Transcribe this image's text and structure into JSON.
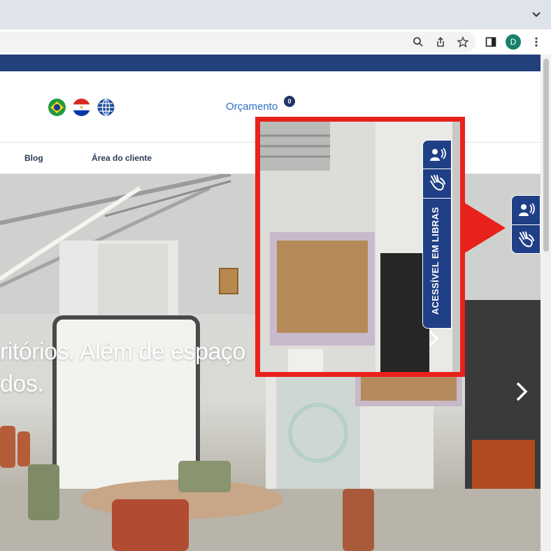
{
  "browser": {
    "profile_initial": "D",
    "icons": [
      "search-icon",
      "share-icon",
      "star-icon",
      "side-panel-icon",
      "kebab-menu-icon",
      "chevron-down-icon"
    ]
  },
  "header": {
    "languages": [
      {
        "name": "brazil-flag-icon"
      },
      {
        "name": "paraguay-flag-icon"
      },
      {
        "name": "globe-icon"
      }
    ],
    "orcamento_label": "Orçamento",
    "orcamento_count": "0"
  },
  "nav": {
    "items": [
      {
        "label": "Blog"
      },
      {
        "label": "Área do cliente"
      }
    ]
  },
  "hero": {
    "line1": "ritórios. Além de espaço",
    "line2": "dos."
  },
  "accessibility_widget": {
    "label": "ACESSÍVEL EM LIBRAS",
    "icons": [
      "audio-speaker-icon",
      "sign-language-hands-icon"
    ]
  },
  "colors": {
    "navy": "#22407a",
    "widget_blue": "#1f3f86",
    "link_blue": "#2a6fc4",
    "callout_red": "#e8221b"
  }
}
